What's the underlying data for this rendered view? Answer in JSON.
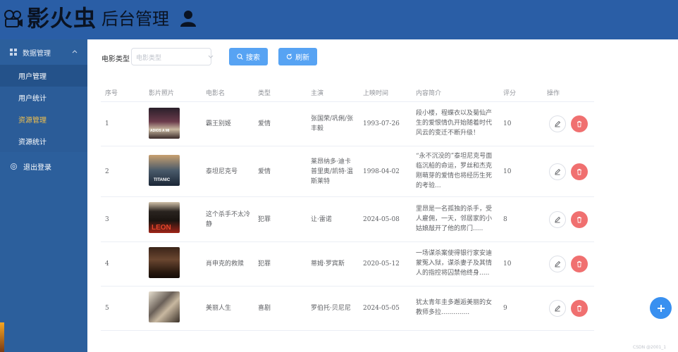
{
  "header": {
    "logo_text": "影火虫",
    "title": "后台管理"
  },
  "sidebar": {
    "group_label": "数据管理",
    "items": [
      {
        "label": "用户管理"
      },
      {
        "label": "用户统计"
      },
      {
        "label": "资源管理"
      },
      {
        "label": "资源统计"
      }
    ],
    "logout_label": "退出登录"
  },
  "toolbar": {
    "filter_label": "电影类型",
    "select_placeholder": "电影类型",
    "search_label": "搜索",
    "refresh_label": "刷新"
  },
  "table": {
    "headers": [
      "序号",
      "影片照片",
      "电影名",
      "类型",
      "主演",
      "上映时间",
      "内容简介",
      "评分",
      "操作"
    ],
    "rows": [
      {
        "no": "1",
        "name": "霸王别姬",
        "type": "爱情",
        "actors": "张国荣/巩俐/张丰毅",
        "date": "1993-07-26",
        "intro": "段小楼，程蝶衣以及菊仙产生的爱恨情仇开始随着时代风云的变迁不断升级！",
        "score": "10",
        "poster_caption": "ADIOS A MI"
      },
      {
        "no": "2",
        "name": "泰坦尼克号",
        "type": "爱情",
        "actors": "莱昂纳多·迪卡普里奥/凯特·温斯莱特",
        "date": "1998-04-02",
        "intro": "“永不沉没的”泰坦尼克号面临沉船的命运，罗丝和杰克刚萌芽的爱情也将经历生死的考验...",
        "score": "10",
        "poster_caption": "TITANIC"
      },
      {
        "no": "3",
        "name": "这个杀手不太冷静",
        "type": "犯罪",
        "actors": "让·雷诺",
        "date": "2024-05-08",
        "intro": "里昂是一名孤独的杀手，受人雇佣，一天，邻居家的小姑娘敲开了他的房门.....",
        "score": "8",
        "poster_caption": "LEON"
      },
      {
        "no": "4",
        "name": "肖申克的救赎",
        "type": "犯罪",
        "actors": "蒂姆·罗宾斯",
        "date": "2020-05-12",
        "intro": "一场谋杀案使得银行家安迪蒙冤入狱，谋杀妻子及其情人的指控将囚禁他终身.....",
        "score": "10",
        "poster_caption": ""
      },
      {
        "no": "5",
        "name": "美丽人生",
        "type": "喜剧",
        "actors": "罗伯托·贝尼尼",
        "date": "2024-05-05",
        "intro": "犹太青年圭多邂逅美丽的女教师多拉..............",
        "score": "9",
        "poster_caption": ""
      }
    ]
  },
  "watermark": "CSDN @2001_1"
}
